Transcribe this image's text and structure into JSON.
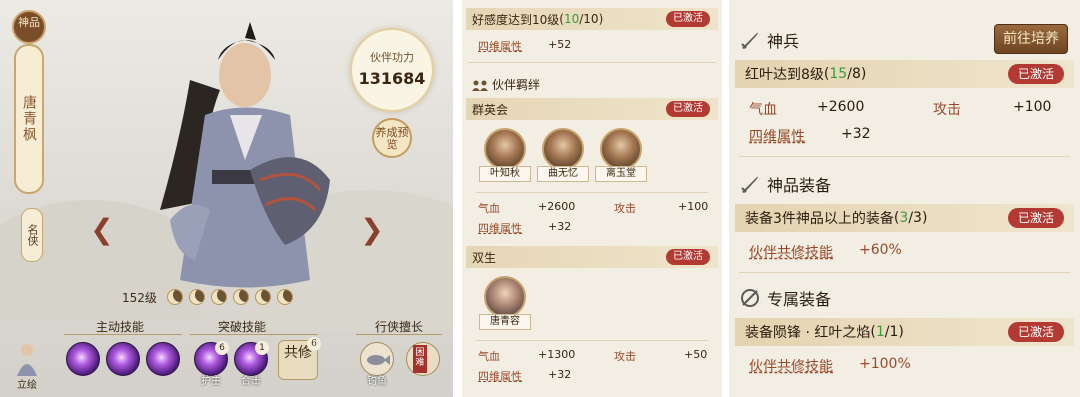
{
  "left": {
    "rank": "神品",
    "name": "唐青枫",
    "title": "名侠",
    "power_label": "伙伴功力",
    "power_value": "131684",
    "preview_label": "养成预览",
    "level": "152级",
    "skill_active_label": "主动技能",
    "skill_break_label": "突破技能",
    "skill_special_label": "行侠擅长",
    "orbs": [
      {
        "label": "",
        "count": ""
      },
      {
        "label": "",
        "count": ""
      },
      {
        "label": "",
        "count": ""
      },
      {
        "label": "护主",
        "count": "6"
      },
      {
        "label": "合击",
        "count": "1"
      }
    ],
    "gongxiu_label": "共修",
    "gongxiu_count": "6",
    "fishing_label": "钓鱼",
    "challenge_label": "困难",
    "portrait_label": "立绘"
  },
  "mid": {
    "top_row": {
      "text": "好感度达到10级",
      "progress": "10",
      "total": "10",
      "status": "已激活"
    },
    "top_attr_label": "四维属性",
    "top_attr_val": "+52",
    "bond_title": "伙伴羁绊",
    "groups": [
      {
        "name": "群英会",
        "status": "已激活",
        "heroes": [
          "叶知秋",
          "曲无忆",
          "离玉堂"
        ],
        "hp_label": "气血",
        "hp_val": "+2600",
        "atk_label": "攻击",
        "atk_val": "+100",
        "attr_label": "四维属性",
        "attr_val": "+32"
      },
      {
        "name": "双生",
        "status": "已激活",
        "heroes": [
          "唐青容"
        ],
        "hp_label": "气血",
        "hp_val": "+1300",
        "atk_label": "攻击",
        "atk_val": "+50",
        "attr_label": "四维属性",
        "attr_val": "+32"
      }
    ]
  },
  "right": {
    "train_button": "前往培养",
    "weapon": {
      "title": "神兵",
      "condition": "红叶达到8级",
      "progress": "15",
      "total": "8",
      "status": "已激活",
      "hp_label": "气血",
      "hp_val": "+2600",
      "atk_label": "攻击",
      "atk_val": "+100",
      "attr_label": "四维属性",
      "attr_val": "+32"
    },
    "gear": {
      "title": "神品装备",
      "condition": "装备3件神品以上的装备",
      "progress": "3",
      "total": "3",
      "status": "已激活",
      "bonus_label": "伙伴共修技能",
      "bonus_val": "+60%"
    },
    "exclusive": {
      "title": "专属装备",
      "condition": "装备陨锋 · 红叶之焰",
      "progress": "1",
      "total": "1",
      "status": "已激活",
      "bonus_label": "伙伴共修技能",
      "bonus_val": "+100%"
    }
  }
}
